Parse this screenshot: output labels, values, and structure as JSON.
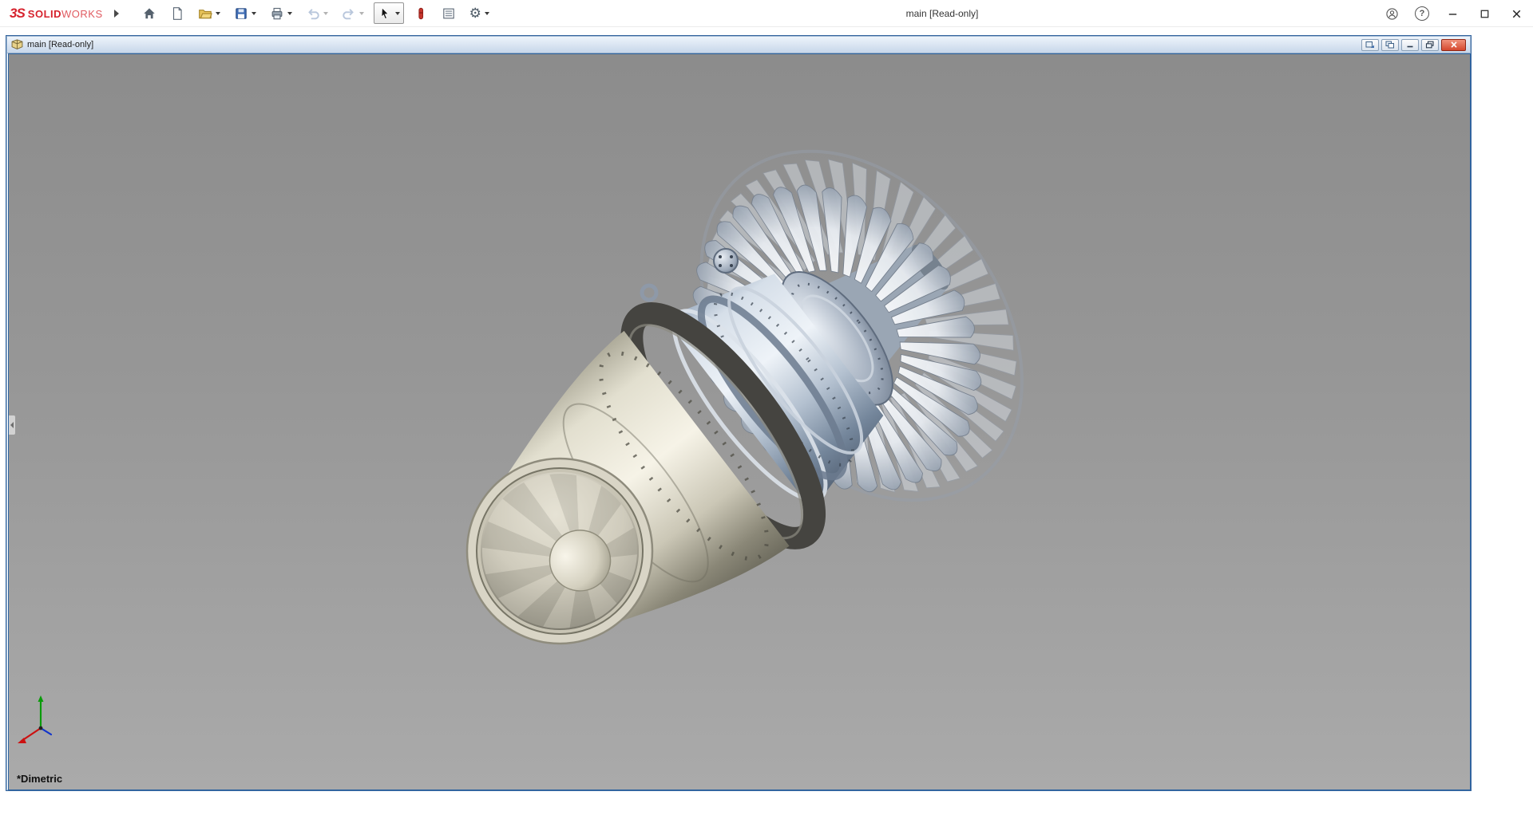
{
  "app": {
    "logo_prefix": "3S",
    "logo_solid": "SOLID",
    "logo_works": "WORKS",
    "title": "main [Read-only]",
    "help_glyph": "?"
  },
  "toolbar": {
    "settings_glyph": "⚙",
    "items": [
      {
        "name": "home"
      },
      {
        "name": "new-document"
      },
      {
        "name": "open"
      },
      {
        "name": "save"
      },
      {
        "name": "print"
      },
      {
        "name": "undo",
        "state": "disabled"
      },
      {
        "name": "redo",
        "state": "disabled"
      },
      {
        "name": "select",
        "state": "active"
      },
      {
        "name": "quick-tool"
      },
      {
        "name": "task-pane"
      },
      {
        "name": "options"
      }
    ]
  },
  "window_controls": {
    "main": [
      "account",
      "help",
      "minimize",
      "maximize",
      "close"
    ],
    "document": [
      "pop-out",
      "arrange",
      "minimize",
      "restore",
      "close"
    ]
  },
  "document_window": {
    "title": "main [Read-only]",
    "view_orientation": "*Dimetric"
  },
  "model": {
    "name": "jet-engine-assembly",
    "front_fan_blade_count": 34,
    "rear_fan_blade_count": 40
  },
  "colors": {
    "accent_blue": "#2e64a0",
    "logo_red": "#d6232e",
    "close_red": "#d4482e",
    "viewport_top": "#8c8c8c",
    "viewport_bottom": "#aaaaaa",
    "triad_x": "#cc1111",
    "triad_y": "#0a9b0a",
    "triad_z": "#1133cc",
    "engine_cream": "#f5f2e6",
    "engine_steel": "#aebccd"
  }
}
